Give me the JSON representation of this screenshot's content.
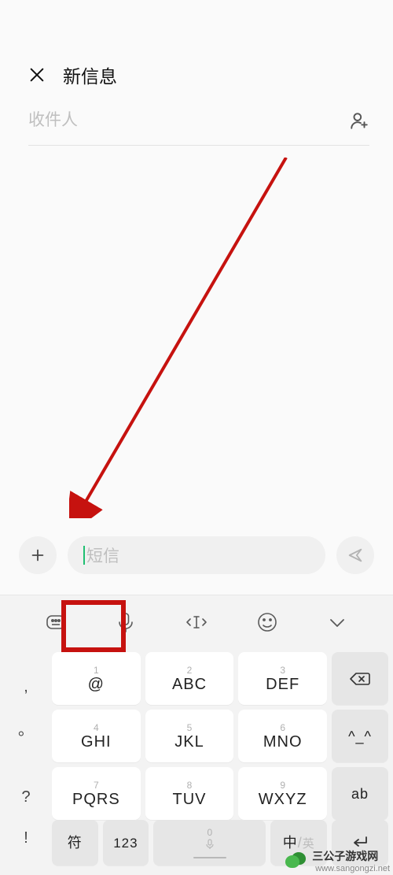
{
  "header": {
    "title": "新信息"
  },
  "recipient": {
    "placeholder": "收件人"
  },
  "compose": {
    "placeholder": "短信"
  },
  "toolbar_icons": [
    "keyboard-icon",
    "mic-icon",
    "cursor-move-icon",
    "emoji-icon",
    "chevron-down-icon"
  ],
  "keypad": {
    "left_column": [
      ",",
      "。",
      "?",
      "!"
    ],
    "keys": [
      {
        "num": "1",
        "label": "@"
      },
      {
        "num": "2",
        "label": "ABC"
      },
      {
        "num": "3",
        "label": "DEF"
      },
      {
        "num": "4",
        "label": "GHI"
      },
      {
        "num": "5",
        "label": "JKL"
      },
      {
        "num": "6",
        "label": "MNO"
      },
      {
        "num": "7",
        "label": "PQRS"
      },
      {
        "num": "8",
        "label": "TUV"
      },
      {
        "num": "9",
        "label": "WXYZ"
      }
    ],
    "right_column": {
      "face": "^_^",
      "ab": "ab"
    },
    "bottom": {
      "sym": "符",
      "num": "123",
      "space_num": "0",
      "lang_zh": "中",
      "lang_en": "英"
    }
  },
  "watermark": {
    "name": "三公子游戏网",
    "domain": "www.sangongzi.net"
  }
}
